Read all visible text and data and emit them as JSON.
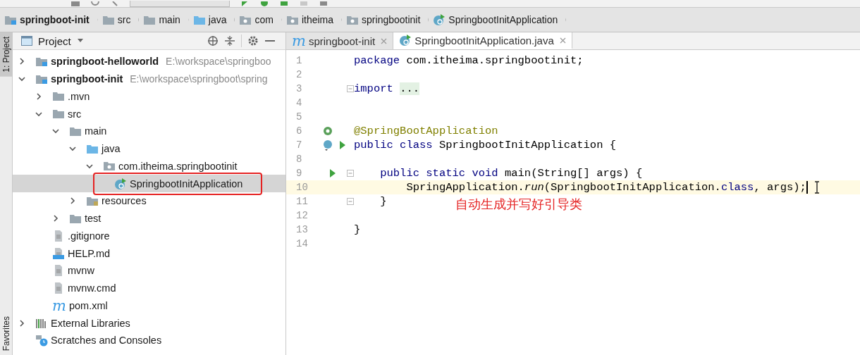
{
  "breadcrumbs": [
    {
      "label": "springboot-init",
      "kind": "module",
      "bold": true
    },
    {
      "label": "src",
      "kind": "folder",
      "bold": false
    },
    {
      "label": "main",
      "kind": "folder",
      "bold": false
    },
    {
      "label": "java",
      "kind": "source",
      "bold": false
    },
    {
      "label": "com",
      "kind": "package",
      "bold": false
    },
    {
      "label": "itheima",
      "kind": "package",
      "bold": false
    },
    {
      "label": "springbootinit",
      "kind": "package",
      "bold": false
    },
    {
      "label": "SpringbootInitApplication",
      "kind": "spring-class",
      "bold": false
    }
  ],
  "side_stripe": [
    {
      "label": "1: Project",
      "selected": true
    },
    {
      "label": "Favorites",
      "selected": false
    }
  ],
  "project": {
    "title": "Project",
    "tree": [
      {
        "label": "springboot-helloworld",
        "path": "E:\\workspace\\springboo",
        "kind": "module",
        "bold": true,
        "expanded": false,
        "selected": false
      },
      {
        "label": "springboot-init",
        "path": "E:\\workspace\\springboot\\spring",
        "kind": "module",
        "bold": true,
        "expanded": true,
        "selected": false,
        "children": [
          {
            "label": ".mvn",
            "kind": "folder",
            "expanded": false,
            "selected": false
          },
          {
            "label": "src",
            "kind": "folder",
            "expanded": true,
            "selected": false,
            "children": [
              {
                "label": "main",
                "kind": "folder",
                "expanded": true,
                "selected": false,
                "children": [
                  {
                    "label": "java",
                    "kind": "source",
                    "expanded": true,
                    "selected": false,
                    "children": [
                      {
                        "label": "com.itheima.springbootinit",
                        "kind": "package",
                        "expanded": true,
                        "selected": false,
                        "children": [
                          {
                            "label": "SpringbootInitApplication",
                            "kind": "spring-class",
                            "selected": true,
                            "highlighted": true
                          }
                        ]
                      }
                    ]
                  },
                  {
                    "label": "resources",
                    "kind": "resources",
                    "expanded": false,
                    "selected": false
                  }
                ]
              },
              {
                "label": "test",
                "kind": "folder",
                "expanded": false,
                "selected": false
              }
            ]
          },
          {
            "label": ".gitignore",
            "kind": "file",
            "selected": false
          },
          {
            "label": "HELP.md",
            "kind": "markdown",
            "selected": false
          },
          {
            "label": "mvnw",
            "kind": "file",
            "selected": false
          },
          {
            "label": "mvnw.cmd",
            "kind": "file",
            "selected": false
          },
          {
            "label": "pom.xml",
            "kind": "maven",
            "glyph": "m",
            "selected": false
          }
        ]
      },
      {
        "label": "External Libraries",
        "kind": "libraries",
        "expanded": false,
        "selected": false
      },
      {
        "label": "Scratches and Consoles",
        "kind": "scratches",
        "selected": false
      }
    ]
  },
  "editor": {
    "tabs": [
      {
        "label": "springboot-init",
        "kind": "maven",
        "glyph": "m",
        "selected": false
      },
      {
        "label": "SpringbootInitApplication.java",
        "kind": "spring-class",
        "selected": true
      }
    ],
    "lines": [
      {
        "number": "1",
        "tokens": [
          {
            "kind": "keyword",
            "text": "package"
          },
          {
            "kind": "plain",
            "text": " com.itheima.springbootinit;"
          }
        ]
      },
      {
        "number": "2"
      },
      {
        "number": "3",
        "fold": true,
        "tokens": [
          {
            "kind": "keyword",
            "text": "import "
          },
          {
            "kind": "folded",
            "text": "..."
          }
        ]
      },
      {
        "number": "4"
      },
      {
        "number": "5"
      },
      {
        "number": "6",
        "gutter": {
          "kind": "bean"
        },
        "tokens": [
          {
            "kind": "annotation",
            "text": "@SpringBootApplication"
          }
        ]
      },
      {
        "number": "7",
        "gutter": {
          "kind": "bean-run"
        },
        "tokens": [
          {
            "kind": "keyword",
            "text": "public class"
          },
          {
            "kind": "plain",
            "text": " SpringbootInitApplication {"
          }
        ]
      },
      {
        "number": "8"
      },
      {
        "number": "9",
        "gutter": {
          "kind": "run"
        },
        "fold": true,
        "tokens": [
          {
            "kind": "keyword",
            "text": "    public static void"
          },
          {
            "kind": "plain",
            "text": " main(String[] args) {"
          }
        ]
      },
      {
        "number": "10",
        "current": true,
        "tokens": [
          {
            "kind": "plain",
            "text": "        SpringApplication."
          },
          {
            "kind": "italic",
            "text": "run"
          },
          {
            "kind": "plain",
            "text": "(SpringbootInitApplication."
          },
          {
            "kind": "keyword",
            "text": "class"
          },
          {
            "kind": "plain",
            "text": ", args);"
          }
        ]
      },
      {
        "number": "11",
        "fold": true,
        "tokens": [
          {
            "kind": "plain",
            "text": "    }"
          }
        ]
      },
      {
        "number": "12"
      },
      {
        "number": "13",
        "tokens": [
          {
            "kind": "plain",
            "text": "}"
          }
        ]
      },
      {
        "number": "14"
      }
    ],
    "annotation": "自动生成并写好引导类"
  }
}
